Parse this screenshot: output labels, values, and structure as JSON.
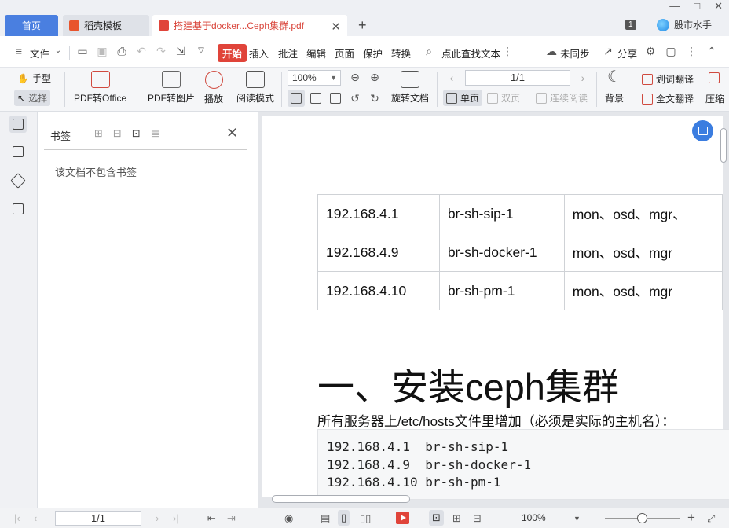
{
  "titlebar": {
    "tabs": [
      {
        "label": "首页"
      },
      {
        "label": "稻壳模板"
      },
      {
        "label": "搭建基于docker...Ceph集群.pdf"
      }
    ],
    "badge": "1",
    "user_label": "股市水手",
    "window_controls": [
      "—",
      "□",
      "✕"
    ]
  },
  "menubar": {
    "file": "文件",
    "start": "开始",
    "insert": "插入",
    "annotate": "批注",
    "edit": "编辑",
    "page": "页面",
    "protect": "保护",
    "convert": "转换",
    "search_text": "点此查找文本",
    "sync": "未同步",
    "share": "分享"
  },
  "ribbon": {
    "hand": "手型",
    "select": "选择",
    "pdf_to_office": "PDF转Office",
    "pdf_to_image": "PDF转图片",
    "play": "播放",
    "read_mode": "阅读模式",
    "zoom": "100%",
    "rotate": "旋转文档",
    "page_display": "1/1",
    "single_page": "单页",
    "double_page": "双页",
    "continuous": "连续阅读",
    "background": "背景",
    "word_translate": "划词翻译",
    "full_translate": "全文翻译",
    "compress": "压缩"
  },
  "bookmark_panel": {
    "title": "书签",
    "empty_text": "该文档不包含书签"
  },
  "document": {
    "table": [
      [
        "192.168.4.1",
        "br-sh-sip-1",
        "mon、osd、mgr、"
      ],
      [
        "192.168.4.9",
        "br-sh-docker-1",
        "mon、osd、mgr"
      ],
      [
        "192.168.4.10",
        "br-sh-pm-1",
        "mon、osd、mgr"
      ]
    ],
    "heading": "一、安装ceph集群",
    "paragraph": "所有服务器上/etc/hosts文件里增加（必须是实际的主机名）：",
    "code_lines": [
      "192.168.4.1  br-sh-sip-1",
      "192.168.4.9  br-sh-docker-1",
      "192.168.4.10 br-sh-pm-1"
    ]
  },
  "statusbar": {
    "page": "1/1",
    "zoom": "100%"
  }
}
